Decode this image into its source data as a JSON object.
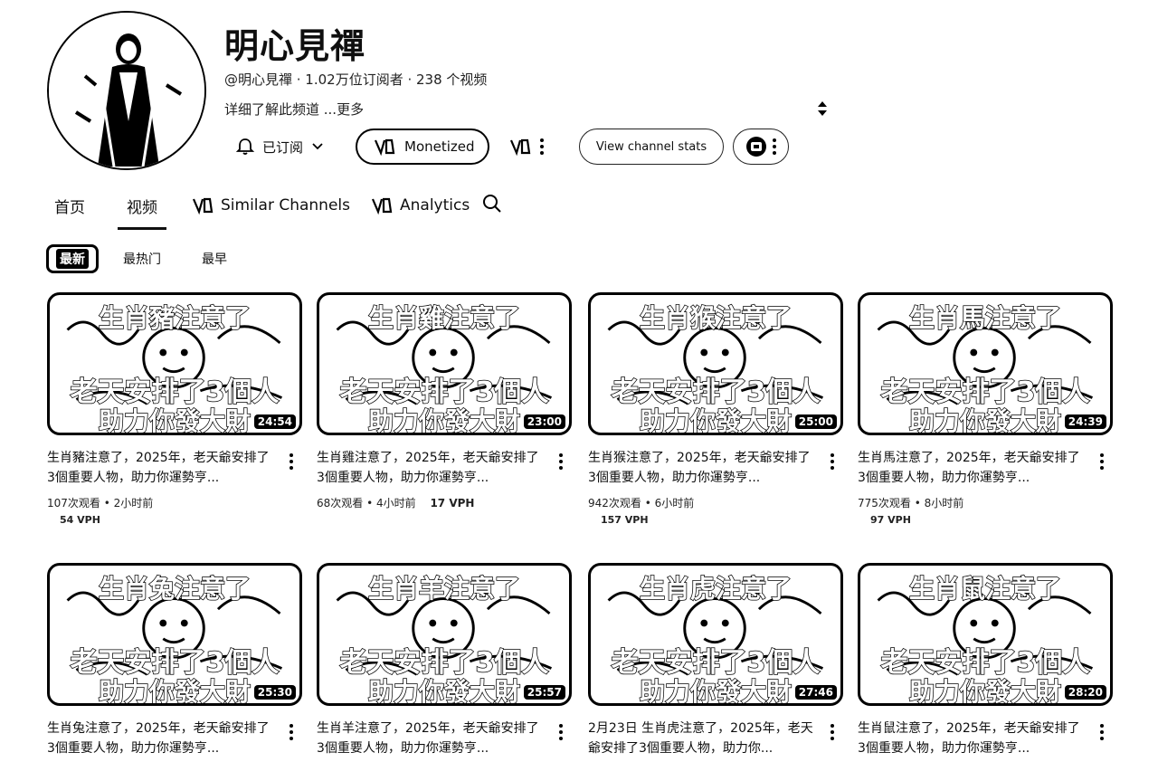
{
  "channel": {
    "name": "明心見禪",
    "meta": "@明心見禪 · 1.02万位订阅者 · 238 个视频",
    "description": "详细了解此频道 ...更多"
  },
  "actions": {
    "subscribed_label": "已订阅",
    "monetized_label": "Monetized",
    "stats_label": "View channel stats"
  },
  "tabs": {
    "home": "首页",
    "videos": "视频",
    "similar": "Similar Channels",
    "analytics": "Analytics"
  },
  "chips": {
    "latest": "最新",
    "popular": "最热门",
    "oldest": "最早"
  },
  "caption": {
    "line2": "老天安排了3個人",
    "line3": "助力你發大財"
  },
  "videos": [
    {
      "headline": "生肖豬注意了",
      "duration": "24:54",
      "title": "生肖豬注意了，2025年，老天爺安排了3個重要人物，助力你運勢亨...",
      "stats": "107次观看 • 2小时前",
      "vph": "54 VPH"
    },
    {
      "headline": "生肖雞注意了",
      "duration": "23:00",
      "title": "生肖雞注意了，2025年，老天爺安排了3個重要人物，助力你運勢亨...",
      "stats": "68次观看 • 4小时前",
      "vph": "17 VPH"
    },
    {
      "headline": "生肖猴注意了",
      "duration": "25:00",
      "title": "生肖猴注意了，2025年，老天爺安排了3個重要人物，助力你運勢亨...",
      "stats": "942次观看 • 6小时前",
      "vph": "157 VPH"
    },
    {
      "headline": "生肖馬注意了",
      "duration": "24:39",
      "title": "生肖馬注意了，2025年，老天爺安排了3個重要人物，助力你運勢亨...",
      "stats": "775次观看 • 8小时前",
      "vph": "97 VPH"
    },
    {
      "headline": "生肖兔注意了",
      "duration": "25:30",
      "title": "生肖兔注意了，2025年，老天爺安排了3個重要人物，助力你運勢亨...",
      "stats": "",
      "vph": ""
    },
    {
      "headline": "生肖羊注意了",
      "duration": "25:57",
      "title": "生肖羊注意了，2025年，老天爺安排了3個重要人物，助力你運勢亨...",
      "stats": "",
      "vph": ""
    },
    {
      "headline": "生肖虎注意了",
      "duration": "27:46",
      "title": "2月23日 生肖虎注意了，2025年，老天爺安排了3個重要人物，助力你...",
      "stats": "",
      "vph": ""
    },
    {
      "headline": "生肖鼠注意了",
      "duration": "28:20",
      "title": "生肖鼠注意了，2025年，老天爺安排了3個重要人物，助力你運勢亨...",
      "stats": "",
      "vph": ""
    }
  ]
}
